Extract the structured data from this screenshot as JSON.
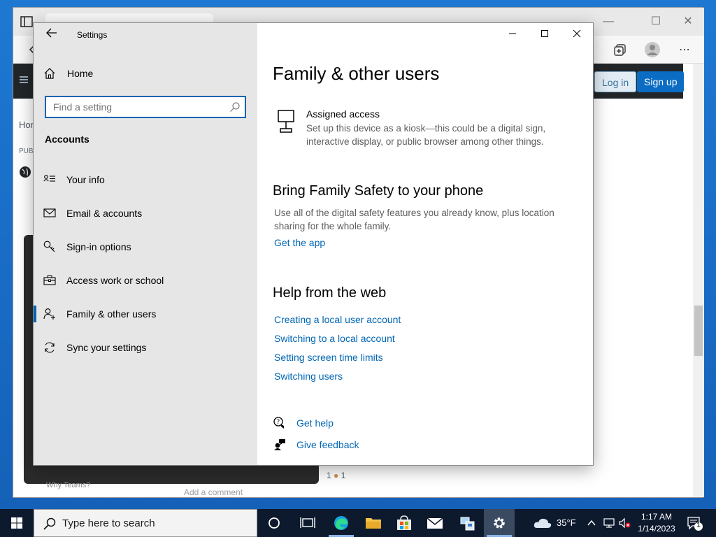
{
  "settings": {
    "title": "Settings",
    "home_label": "Home",
    "search_placeholder": "Find a setting",
    "section": "Accounts",
    "nav": [
      {
        "label": "Your info"
      },
      {
        "label": "Email & accounts"
      },
      {
        "label": "Sign-in options"
      },
      {
        "label": "Access work or school"
      },
      {
        "label": "Family & other users"
      },
      {
        "label": "Sync your settings"
      }
    ],
    "main": {
      "page_title": "Family & other users",
      "assigned_access": {
        "title": "Assigned access",
        "desc_line1": "Set up this device as a kiosk—this could be a digital sign,",
        "desc_line2": "interactive display, or public browser among other things."
      },
      "family_safety": {
        "heading": "Bring Family Safety to your phone",
        "desc_line1": "Use all of the digital safety features you already know, plus location",
        "desc_line2": "sharing for the whole family.",
        "link": "Get the app"
      },
      "help_web": {
        "heading": "Help from the web",
        "links": [
          "Creating a local user account",
          "Switching to a local account",
          "Setting screen time limits",
          "Switching users"
        ]
      },
      "get_help": "Get help",
      "give_feedback": "Give feedback"
    }
  },
  "browser": {
    "login_label": "Log in",
    "signup_label": "Sign up",
    "side_home": "Hon",
    "side_public": "PUBL",
    "teams_why": "Why Teams?",
    "add_comment": "Add a comment",
    "votes_a": "1",
    "votes_b": "1"
  },
  "taskbar": {
    "search_text": "Type here to search",
    "weather": "35°F",
    "time": "1:17 AM",
    "date": "1/14/2023",
    "notification_count": "1"
  },
  "colors": {
    "accent": "#0063b1",
    "link": "#0066b4",
    "sidebar_bg": "#e6e6e6"
  }
}
